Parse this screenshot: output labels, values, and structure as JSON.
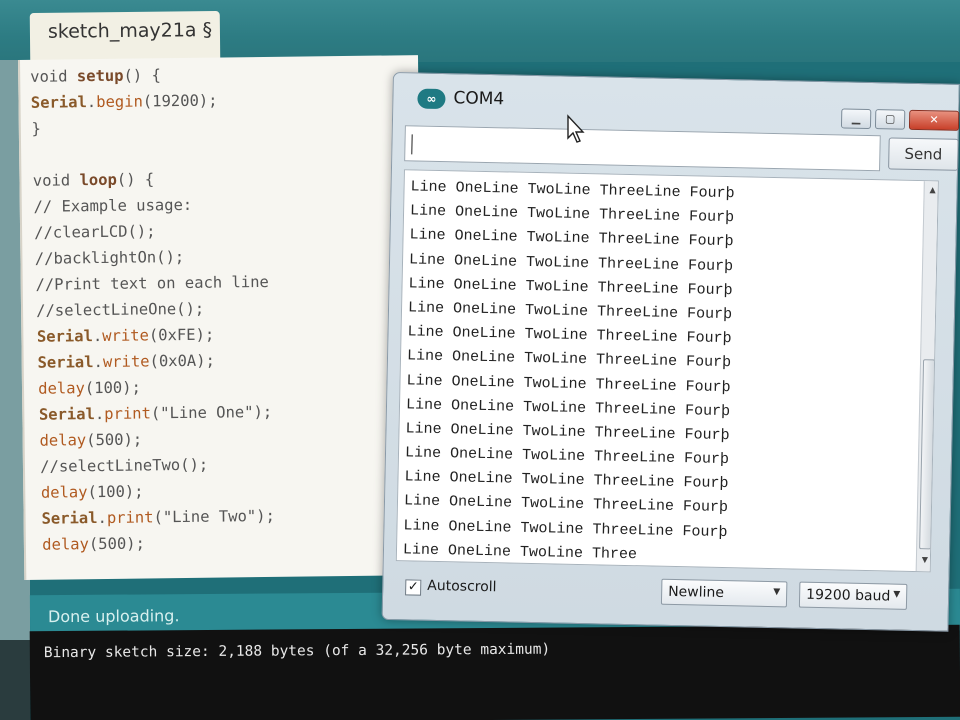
{
  "ide": {
    "tab_label": "sketch_may21a §",
    "code_lines": [
      {
        "a": "void ",
        "fn": "setup",
        "b": "() {"
      },
      {
        "obj": "Serial",
        "dot": ".",
        "m": "begin",
        "b": "(19200);"
      },
      {
        "b": "}"
      },
      {
        "b": ""
      },
      {
        "a": "void ",
        "fn": "loop",
        "b": "() {"
      },
      {
        "b": "// Example usage:"
      },
      {
        "b": "//clearLCD();"
      },
      {
        "b": "//backlightOn();"
      },
      {
        "b": "//Print text on each line"
      },
      {
        "b": "//selectLineOne();"
      },
      {
        "obj": "Serial",
        "dot": ".",
        "m": "write",
        "b": "(0xFE);"
      },
      {
        "obj": "Serial",
        "dot": ".",
        "m": "write",
        "b": "(0x0A);"
      },
      {
        "m": "delay",
        "b": "(100);"
      },
      {
        "obj": "Serial",
        "dot": ".",
        "m": "print",
        "b": "(\"Line One\");"
      },
      {
        "m": "delay",
        "b": "(500);"
      },
      {
        "b": "//selectLineTwo();"
      },
      {
        "m": "delay",
        "b": "(100);"
      },
      {
        "obj": "Serial",
        "dot": ".",
        "m": "print",
        "b": "(\"Line Two\");"
      },
      {
        "m": "delay",
        "b": "(500);"
      }
    ],
    "status": "Done uploading.",
    "console": "Binary sketch size: 2,188 bytes (of a 32,256 byte maximum)"
  },
  "serial_monitor": {
    "title": "COM4",
    "app_icon": "arduino-logo-icon",
    "input_value": "",
    "send_label": "Send",
    "output_lines": [
      "Line OneLine TwoLine ThreeLine Fourþ",
      "Line OneLine TwoLine ThreeLine Fourþ",
      "Line OneLine TwoLine ThreeLine Fourþ",
      "Line OneLine TwoLine ThreeLine Fourþ",
      "Line OneLine TwoLine ThreeLine Fourþ",
      "Line OneLine TwoLine ThreeLine Fourþ",
      "Line OneLine TwoLine ThreeLine Fourþ",
      "Line OneLine TwoLine ThreeLine Fourþ",
      "Line OneLine TwoLine ThreeLine Fourþ",
      "Line OneLine TwoLine ThreeLine Fourþ",
      "Line OneLine TwoLine ThreeLine Fourþ",
      "Line OneLine TwoLine ThreeLine Fourþ",
      "Line OneLine TwoLine ThreeLine Fourþ",
      "Line OneLine TwoLine ThreeLine Fourþ",
      "Line OneLine TwoLine ThreeLine Fourþ",
      "Line OneLine TwoLine Three"
    ],
    "autoscroll_label": "Autoscroll",
    "autoscroll_checked": true,
    "line_ending": "Newline",
    "baud_rate": "19200 baud"
  },
  "colors": {
    "ide_teal": "#2b8a93",
    "close_red": "#c8402a"
  }
}
